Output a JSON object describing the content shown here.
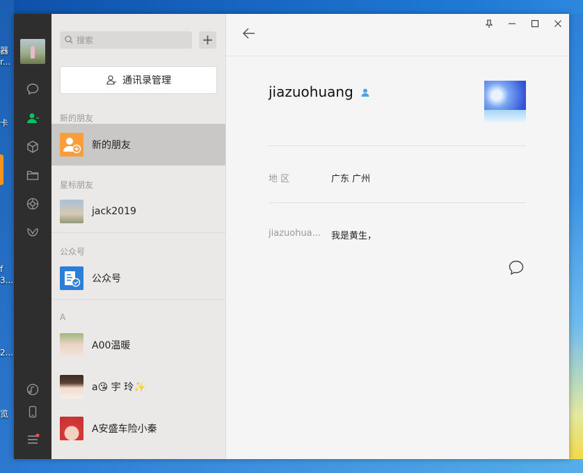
{
  "desktop": {
    "frag_1": "器",
    "frag_2": "r...",
    "frag_3": "卡",
    "frag_4": "f",
    "frag_5": "3...",
    "frag_6": "2...",
    "frag_7": "览"
  },
  "search": {
    "placeholder": "搜索"
  },
  "add_label": "+",
  "contacts_manage_label": "通讯录管理",
  "sections": {
    "new_friends": "新的朋友",
    "starred": "星标朋友",
    "official": "公众号",
    "a": "A"
  },
  "items": [
    {
      "name": "新的朋友",
      "selected": true,
      "avatar": "new-friend-icon"
    },
    {
      "name": "jack2019",
      "avatar": "photo"
    },
    {
      "name": "公众号",
      "avatar": "official-account-icon"
    },
    {
      "name": "A00温暖",
      "avatar": "photo"
    },
    {
      "name": "a😘 宇 玲✨",
      "avatar": "photo"
    },
    {
      "name": "A安盛车险小秦",
      "avatar": "photo"
    }
  ],
  "profile": {
    "name": "jiazuohuang",
    "gender_icon": "male-icon",
    "region_label": "地  区",
    "region_value": "广东 广州",
    "signature_label": "jiazuohua...",
    "signature_value": "我是黄生，"
  },
  "colors": {
    "accent_green": "#07c160",
    "sidebar": "#2e2e2e",
    "new_friend_orange": "#fa9d3b",
    "official_blue": "#2b7fd9",
    "gender_blue": "#49a5e6"
  }
}
